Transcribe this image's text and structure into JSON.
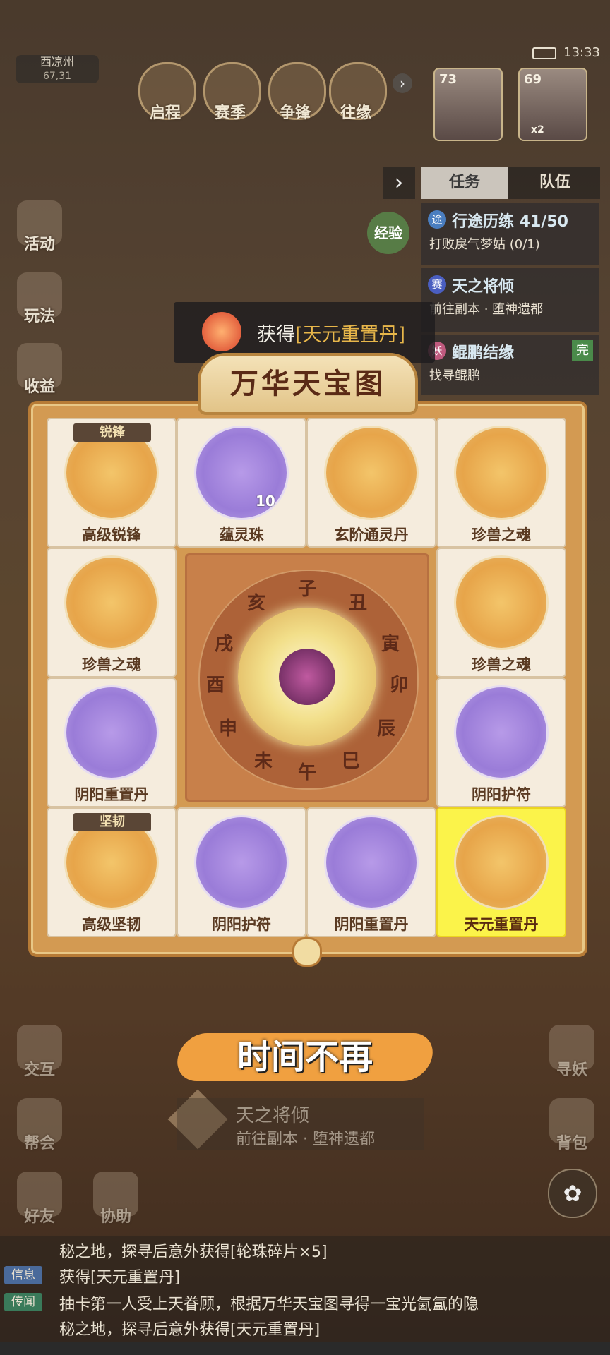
{
  "status": {
    "time": "13:33"
  },
  "location": {
    "name": "西凉州",
    "coords": "67,31"
  },
  "top_menu": [
    {
      "label": "启程",
      "icon": "journey-icon"
    },
    {
      "label": "赛季",
      "icon": "season-icon"
    },
    {
      "label": "争锋",
      "icon": "contest-icon"
    },
    {
      "label": "往缘",
      "icon": "bond-icon"
    }
  ],
  "party": [
    {
      "level": "73"
    },
    {
      "level": "69",
      "count": "x2"
    }
  ],
  "side_left": [
    {
      "label": "活动"
    },
    {
      "label": "玩法"
    },
    {
      "label": "收益"
    }
  ],
  "exp_label": "经验",
  "task_panel": {
    "tabs": [
      "任务",
      "队伍"
    ],
    "tasks": [
      {
        "badge": "途",
        "title": "行途历练 41/50",
        "sub": "打败戾气梦姑 (0/1)"
      },
      {
        "badge": "赛",
        "title": "天之将倾",
        "sub": "前往副本 · 堕神遗都"
      },
      {
        "badge": "妖",
        "title": "鲲鹏结缘",
        "sub": "找寻鲲鹏",
        "status": "完"
      }
    ]
  },
  "toast": {
    "prefix": "获得",
    "item": "[天元重置丹]"
  },
  "board": {
    "title": "万华天宝图",
    "cells": [
      {
        "label": "高级锐锋",
        "tag": "锐锋",
        "style": "gold",
        "icon": "scroll-icon"
      },
      {
        "label": "蕴灵珠",
        "count": "10",
        "style": "purple",
        "icon": "jade-bead-icon"
      },
      {
        "label": "玄阶通灵丹",
        "style": "gold",
        "icon": "blue-orb-icon"
      },
      {
        "label": "珍兽之魂",
        "style": "gold",
        "icon": "purple-orb-icon"
      },
      {
        "label": "珍兽之魂",
        "style": "gold",
        "icon": "purple-orb-icon"
      },
      {
        "label": "珍兽之魂",
        "style": "gold",
        "icon": "purple-orb-icon"
      },
      {
        "label": "阴阳重置丹",
        "style": "purple",
        "icon": "pill-orb-icon"
      },
      {
        "label": "阴阳护符",
        "style": "purple",
        "icon": "amulet-icon"
      },
      {
        "label": "高级坚韧",
        "tag": "坚韧",
        "style": "gold",
        "icon": "scroll-icon"
      },
      {
        "label": "阴阳护符",
        "style": "purple",
        "icon": "amulet-icon"
      },
      {
        "label": "阴阳重置丹",
        "style": "purple",
        "icon": "pill-orb-icon"
      },
      {
        "label": "天元重置丹",
        "style": "gold",
        "icon": "red-orb-icon",
        "highlighted": true
      }
    ],
    "zodiac": [
      "子",
      "丑",
      "寅",
      "卯",
      "辰",
      "巳",
      "午",
      "未",
      "申",
      "酉",
      "戌",
      "亥"
    ]
  },
  "slogan": "时间不再",
  "bottom_quest": {
    "title": "天之将倾",
    "sub": "前往副本 · 堕神遗都"
  },
  "side_bottom_left": [
    {
      "label": "交互"
    },
    {
      "label": "帮会"
    },
    {
      "label": "好友"
    },
    {
      "label": "协助"
    }
  ],
  "side_bottom_right": [
    {
      "label": "寻妖"
    },
    {
      "label": "背包"
    }
  ],
  "chat": [
    {
      "tag": "",
      "text": "秘之地，探寻后意外获得[轮珠碎片×5]"
    },
    {
      "tag": "信息",
      "text": "获得[天元重置丹]"
    },
    {
      "tag": "传闻",
      "text": "抽卡第一人受上天眷顾，根据万华天宝图寻得一宝光氤氲的隐"
    },
    {
      "tag": "",
      "text": "秘之地，探寻后意外获得[天元重置丹]"
    }
  ]
}
